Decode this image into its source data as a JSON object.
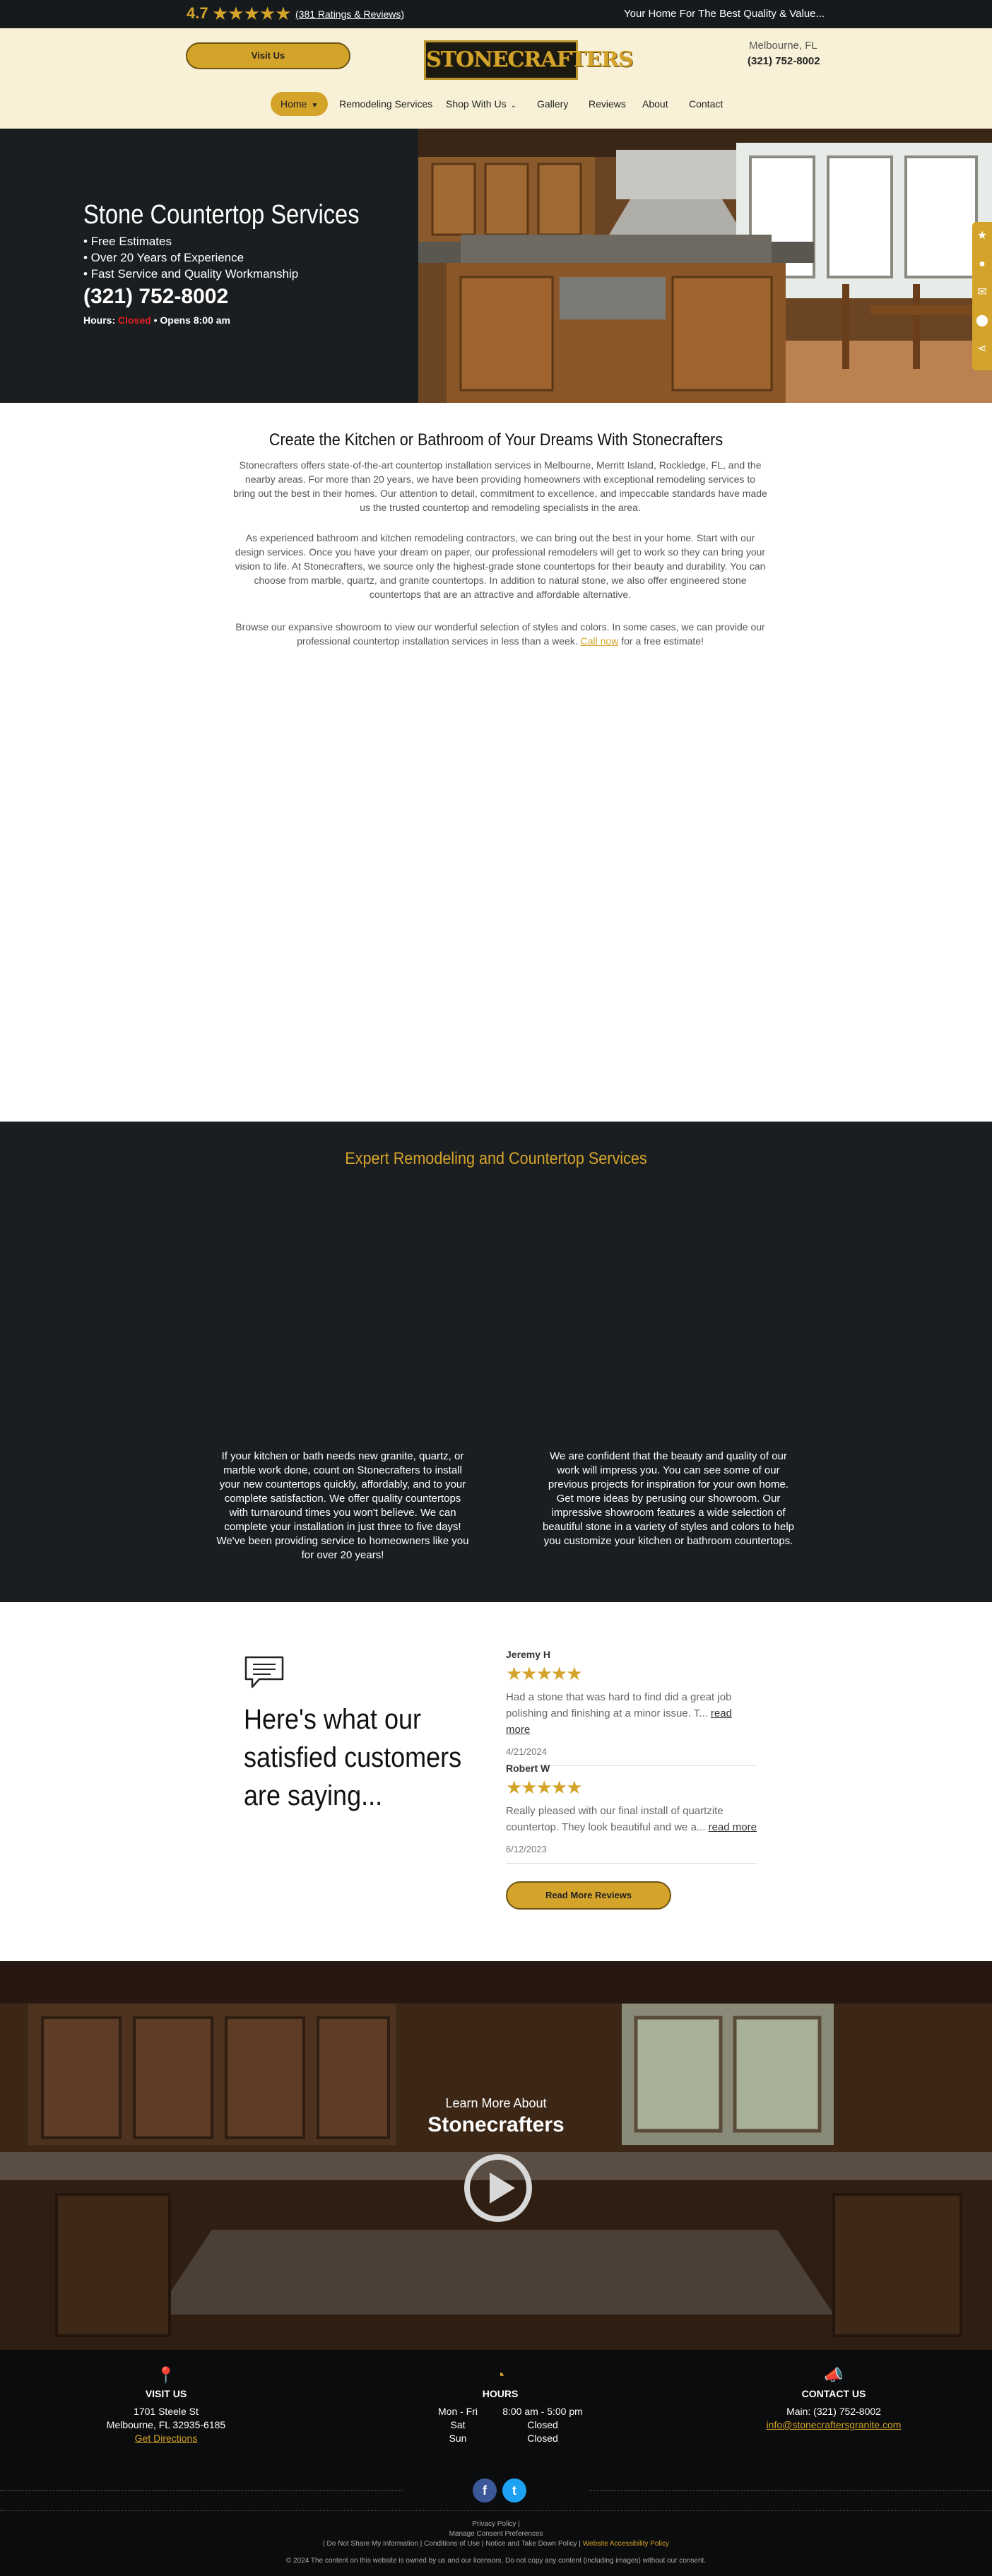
{
  "topbar": {
    "rating": "4.7",
    "stars": "★★★★★",
    "ratings_link": "(381 Ratings & Reviews)",
    "tagline": "Your Home For The Best Quality & Value..."
  },
  "header": {
    "visit_button": "Visit Us",
    "logo_text": "STONECRAFTERS",
    "location": "Melbourne, FL",
    "phone": "(321) 752-8002"
  },
  "nav": [
    {
      "label": "Home",
      "has_menu": true
    },
    {
      "label": "Remodeling Services",
      "has_menu": false
    },
    {
      "label": "Shop With Us",
      "has_menu": true
    },
    {
      "label": "Gallery",
      "has_menu": false
    },
    {
      "label": "Reviews",
      "has_menu": false
    },
    {
      "label": "About",
      "has_menu": false
    },
    {
      "label": "Contact",
      "has_menu": false
    }
  ],
  "hero": {
    "title": "Stone Countertop Services",
    "bullets": [
      "• Free Estimates",
      "• Over 20 Years of Experience",
      "• Fast Service and Quality Workmanship"
    ],
    "phone": "(321) 752-8002",
    "hours_label": "Hours:",
    "hours_status": "Closed",
    "hours_next": "• Opens 8:00 am"
  },
  "intro": {
    "title": "Create the Kitchen or Bathroom of Your Dreams With Stonecrafters",
    "p1": "Stonecrafters offers state-of-the-art countertop installation services in Melbourne, Merritt Island, Rockledge, FL, and the nearby areas. For more than 20 years, we have been providing homeowners with exceptional remodeling services to bring out the best in their homes. Our attention to detail, commitment to excellence, and impeccable standards have made us the trusted countertop and remodeling specialists in the area.",
    "p2": "As experienced bathroom and kitchen remodeling contractors, we can bring out the best in your home. Start with our design services. Once you have your dream on paper, our professional remodelers will get to work so they can bring your vision to life. At Stonecrafters, we source only the highest-grade stone countertops for their beauty and durability. You can choose from marble, quartz, and granite countertops. In addition to natural stone, we also offer engineered stone countertops that are an attractive and affordable alternative.",
    "p3_before": "Browse our expansive showroom to view our wonderful selection of styles and colors. In some cases, we can provide our professional countertop installation services in less than a week. ",
    "p3_link": "Call now",
    "p3_after": " for a free estimate!"
  },
  "expert": {
    "title": "Expert Remodeling and Countertop Services",
    "left": "If your kitchen or bath needs new granite, quartz, or marble work done, count on Stonecrafters to install your new countertops quickly, affordably, and to your complete satisfaction. We offer quality countertops with turnaround times you won't believe. We can complete your installation in just three to five days! We've been providing service to homeowners like you for over 20 years!",
    "right": "We are confident that the beauty and quality of our work will impress you. You can see some of our previous projects for inspiration for your own home. Get more ideas by perusing our showroom. Our impressive showroom features a wide selection of beautiful stone in a variety of styles and colors to help you customize your kitchen or bathroom countertops."
  },
  "reviews": {
    "heading": "Here's what our satisfied customers are saying...",
    "items": [
      {
        "name": "Jeremy H",
        "stars": "★★★★★",
        "text": "Had a stone that was hard to find did a great job polishing and finishing at a minor issue. T...",
        "more": "read more",
        "date": "4/21/2024"
      },
      {
        "name": "Robert W",
        "stars": "★★★★★",
        "text": "Really pleased with our final install of quartzite countertop. They look beautiful and we a...",
        "more": "read more",
        "date": "6/12/2023"
      }
    ],
    "button": "Read More Reviews"
  },
  "video": {
    "subtitle": "Learn More About",
    "title": "Stonecrafters"
  },
  "footer": {
    "visit": {
      "heading": "VISIT US",
      "line1": "1701 Steele St",
      "line2": "Melbourne, FL 32935-6185",
      "link": "Get Directions"
    },
    "hours": {
      "heading": "HOURS",
      "rows": [
        [
          "Mon - Fri",
          "8:00 am - 5:00 pm"
        ],
        [
          "Sat",
          "Closed"
        ],
        [
          "Sun",
          "Closed"
        ]
      ]
    },
    "contact": {
      "heading": "CONTACT US",
      "main": "Main: (321) 752-8002",
      "email": "info@stonecraftersgranite.com"
    },
    "legal1": "Privacy Policy |",
    "legal2": "Manage Consent Preferences",
    "legal3_a": "| Do Not Share My Information | Conditions of Use | Notice and Take Down Policy | ",
    "legal3_b": "Website Accessibility Policy",
    "copyright": "© 2024 The content on this website is owned by us and our licensors. Do not copy any content (including images) without our consent."
  },
  "colors": {
    "accent": "#d4a32a",
    "dark": "#1b1e20",
    "cream": "#f8f1d7"
  }
}
